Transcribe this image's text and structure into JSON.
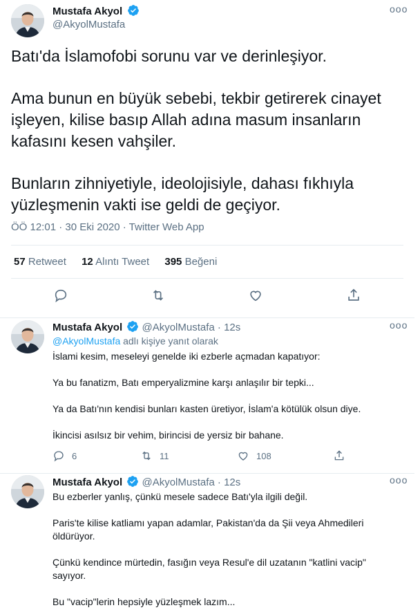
{
  "main_tweet": {
    "author_name": "Mustafa Akyol",
    "author_handle": "@AkyolMustafa",
    "more_label": "ooo",
    "paragraphs": [
      "Batı'da İslamofobi sorunu var ve derinleşiyor.",
      "Ama bunun en büyük sebebi, tekbir getirerek cinayet işleyen, kilise basıp Allah adına masum insanların kafasını kesen vahşiler.",
      "Bunların zihniyetiyle, ideolojisiyle, dahası fıkhıyla yüzleşmenin vakti ise geldi de geçiyor."
    ],
    "timestamp": "ÖÖ 12:01 · 30 Eki 2020 · Twitter Web App",
    "stats": {
      "retweets_count": "57",
      "retweets_label": "Retweet",
      "quotes_count": "12",
      "quotes_label": "Alıntı Tweet",
      "likes_count": "395",
      "likes_label": "Beğeni"
    },
    "actions": [
      "reply-icon",
      "retweet-icon",
      "like-icon",
      "share-icon"
    ]
  },
  "replies": [
    {
      "author_name": "Mustafa Akyol",
      "author_handle": "@AkyolMustafa",
      "dot": "·",
      "time": "12s",
      "more_label": "ooo",
      "reply_to_mention": "@AkyolMustafa",
      "reply_to_suffix": "adlı kişiye yanıt olarak",
      "paragraphs": [
        "İslami kesim, meseleyi genelde iki ezberle açmadan kapatıyor:",
        "Ya bu fanatizm, Batı emperyalizmine karşı anlaşılır bir tepki...",
        "Ya da Batı'nın kendisi bunları kasten üretiyor, İslam'a kötülük olsun diye.",
        "İkincisi asılsız bir vehim, birincisi de yersiz bir bahane."
      ],
      "reply_count": "6",
      "retweet_count": "11",
      "like_count": "108"
    },
    {
      "author_name": "Mustafa Akyol",
      "author_handle": "@AkyolMustafa",
      "dot": "·",
      "time": "12s",
      "more_label": "ooo",
      "paragraphs": [
        "Bu ezberler yanlış, çünkü mesele sadece Batı'yla ilgili değil.",
        "Paris'te kilise katliamı yapan adamlar, Pakistan'da da Şii veya Ahmedileri öldürüyor.",
        "Çünkü kendince mürtedin, fasığın veya Resul'e dil uzatanın \"katlini vacip\" sayıyor.",
        "Bu \"vacip\"lerin hepsiyle yüzleşmek lazım..."
      ]
    }
  ],
  "colors": {
    "accent": "#1da1f2",
    "text": "#0f1419",
    "secondary": "#5b7083",
    "divider": "#e6ecf0"
  }
}
